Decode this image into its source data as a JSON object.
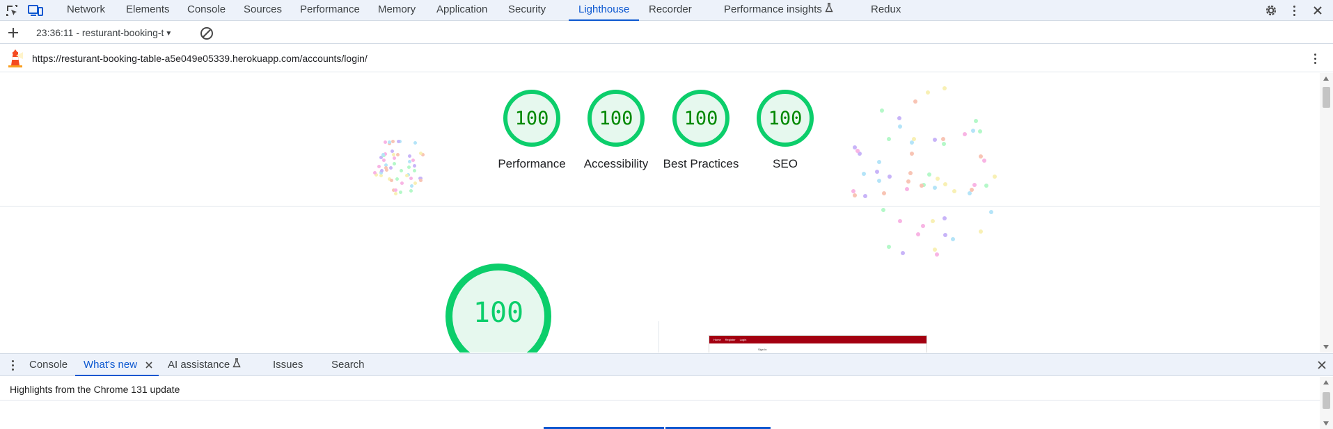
{
  "main_tabs": [
    {
      "label": "Network"
    },
    {
      "label": "Elements"
    },
    {
      "label": "Console"
    },
    {
      "label": "Sources"
    },
    {
      "label": "Performance"
    },
    {
      "label": "Memory"
    },
    {
      "label": "Application"
    },
    {
      "label": "Security"
    },
    {
      "label": "Lighthouse",
      "active": true
    },
    {
      "label": "Recorder"
    },
    {
      "label": "Performance insights",
      "experimental": true
    },
    {
      "label": "Redux"
    }
  ],
  "lighthouse_toolbar": {
    "report_select": "23:36:11 - resturant-booking-t"
  },
  "url_bar": {
    "url": "https://resturant-booking-table-a5e049e05339.herokuapp.com/accounts/login/"
  },
  "scores": [
    {
      "value": "100",
      "label": "Performance"
    },
    {
      "value": "100",
      "label": "Accessibility"
    },
    {
      "value": "100",
      "label": "Best Practices"
    },
    {
      "value": "100",
      "label": "SEO"
    }
  ],
  "main_score": {
    "value": "100"
  },
  "screenshot_preview": {
    "nav_items": [
      "Home",
      "Register",
      "Login"
    ],
    "title": "Sign In"
  },
  "drawer": {
    "tabs": [
      {
        "label": "Console"
      },
      {
        "label": "What's new",
        "active": true,
        "closable": true
      },
      {
        "label": "AI assistance",
        "experimental": true
      },
      {
        "label": "Issues"
      },
      {
        "label": "Search"
      }
    ],
    "heading": "Highlights from the Chrome 131 update"
  },
  "colors": {
    "accent": "#0b57d0",
    "score_pass": "#0cce6b",
    "score_text": "#008800",
    "score_bg": "#e6f8ee",
    "tabbar_bg": "#edf2fa"
  },
  "icons": {
    "inspect": "inspect-element-icon",
    "device": "device-toolbar-icon",
    "settings": "gear-icon",
    "more": "more-vertical-icon",
    "close": "close-icon",
    "add": "plus-icon",
    "clear": "clear-icon",
    "lighthouse": "lighthouse-logo-icon",
    "flask": "flask-icon"
  }
}
